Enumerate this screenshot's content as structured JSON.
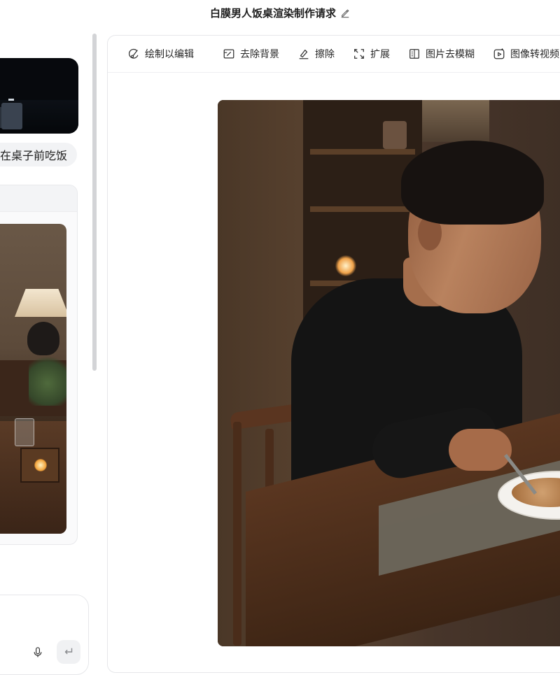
{
  "header": {
    "title": "白膜男人饭桌渲染制作请求"
  },
  "chat": {
    "user_message": "在桌子前吃饭"
  },
  "toolbar": {
    "draw_edit": "绘制以编辑",
    "remove_bg": "去除背景",
    "erase": "擦除",
    "expand": "扩展",
    "deblur": "图片去模糊",
    "to_video": "图像转视频"
  },
  "colors": {
    "panel_border": "#e6e7ea",
    "scrollbar": "#d3d4d7",
    "bubble_bg": "#f2f3f5"
  },
  "icons": {
    "title_edit": "pencil-icon",
    "draw_edit": "brush-edit-icon",
    "remove_bg": "remove-background-icon",
    "erase": "eraser-icon",
    "expand": "expand-icon",
    "deblur": "deblur-icon",
    "to_video": "image-to-video-icon",
    "mic": "microphone-icon",
    "send": "enter-icon"
  }
}
